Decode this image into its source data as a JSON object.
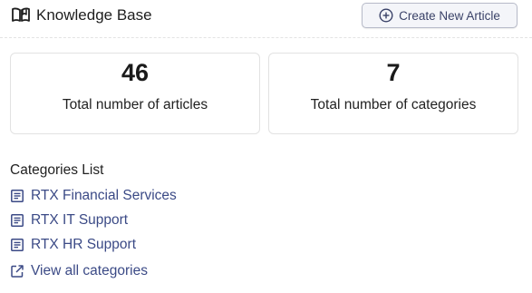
{
  "header": {
    "title": "Knowledge Base",
    "create_button_label": "Create New Article"
  },
  "stats": {
    "articles": {
      "value": "46",
      "label": "Total number of articles"
    },
    "categories": {
      "value": "7",
      "label": "Total number of categories"
    }
  },
  "categories_list": {
    "heading": "Categories List",
    "items": [
      {
        "label": "RTX Financial Services"
      },
      {
        "label": "RTX IT Support"
      },
      {
        "label": "RTX HR Support"
      }
    ],
    "view_all_label": "View all categories"
  },
  "colors": {
    "link": "#3b4a86",
    "button_background": "#f4f5f9",
    "button_border": "#b7bac8",
    "card_border": "#e2e2e2"
  },
  "icons": {
    "header": "open-book-icon",
    "create_button": "plus-circle-icon",
    "category_item": "document-icon",
    "view_all": "external-link-icon"
  }
}
